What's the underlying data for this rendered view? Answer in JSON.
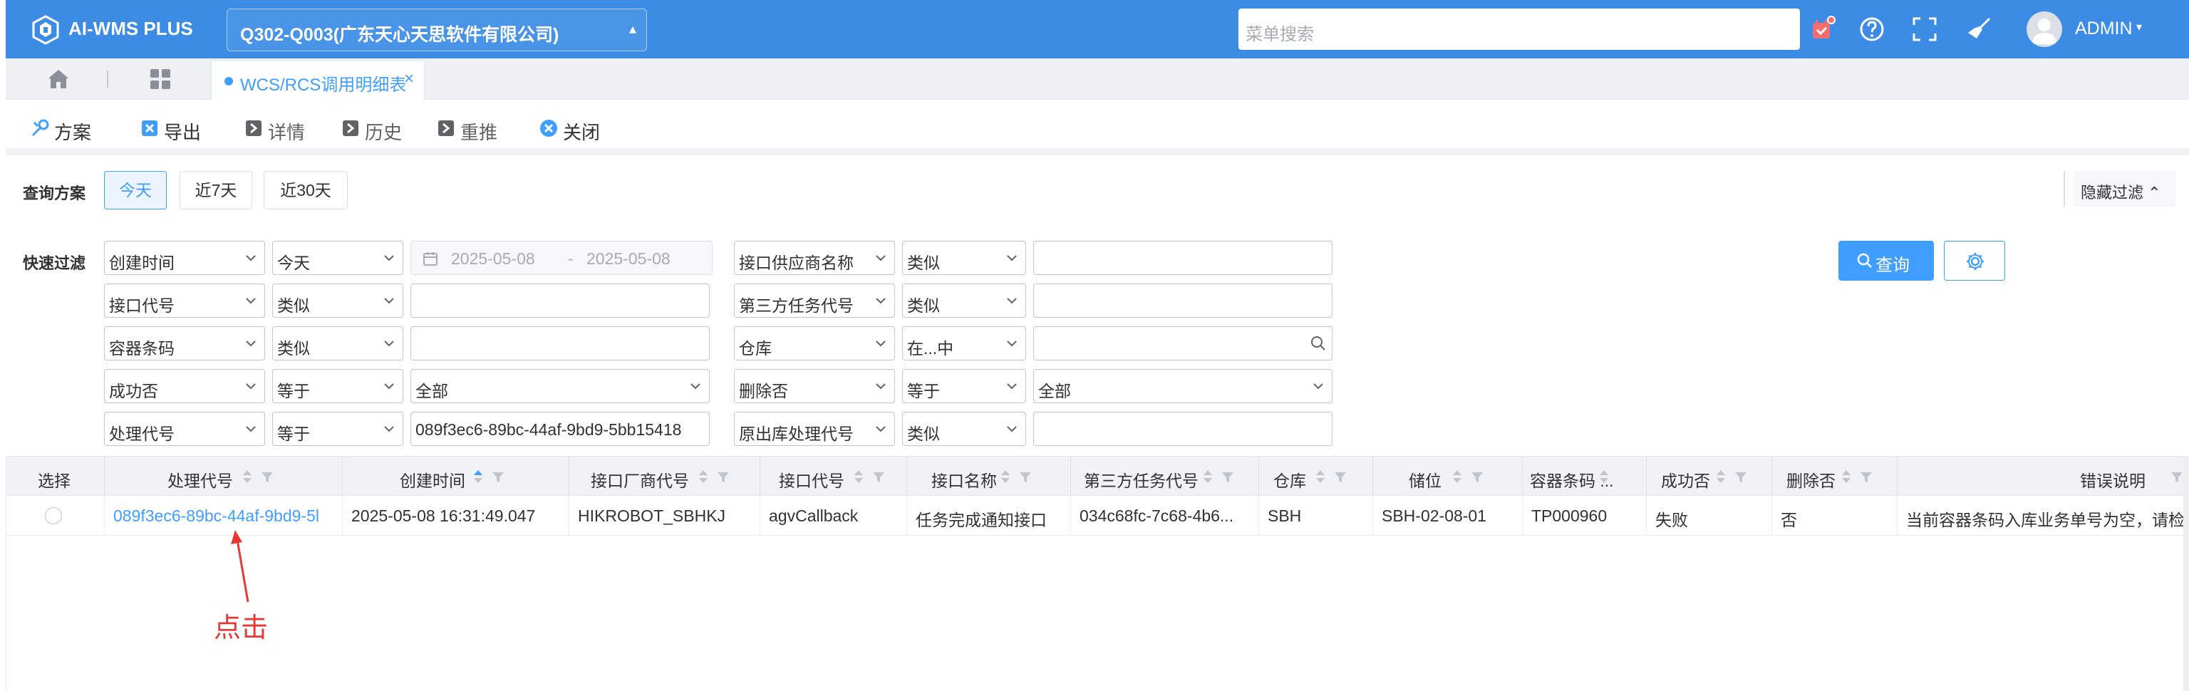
{
  "header": {
    "app_title": "AI-WMS PLUS",
    "project": "Q302-Q003(广东天心天思软件有限公司)",
    "menu_search_placeholder": "菜单搜索",
    "user": "ADMIN",
    "colors": {
      "topbar": "#3c8ce6",
      "accent": "#409eff",
      "notice_badge": "#f56c6c"
    }
  },
  "tabs": {
    "active_label": "WCS/RCS调用明细表",
    "close_glyph": "×"
  },
  "toolbar": {
    "scheme": "方案",
    "export": "导出",
    "detail": "详情",
    "history": "历史",
    "repush": "重推",
    "close": "关闭"
  },
  "query_scheme": {
    "label": "查询方案",
    "options": [
      "今天",
      "近7天",
      "近30天"
    ],
    "active": "今天",
    "hide_filter": "隐藏过滤"
  },
  "quick_filter": {
    "label": "快速过滤",
    "rows": [
      {
        "field": "创建时间",
        "op": "今天",
        "date_from": "2025-05-08",
        "date_sep": "-",
        "date_to": "2025-05-08",
        "field2": "接口供应商名称",
        "op2": "类似",
        "value2": ""
      },
      {
        "field": "接口代号",
        "op": "类似",
        "value": "",
        "field2": "第三方任务代号",
        "op2": "类似",
        "value2": ""
      },
      {
        "field": "容器条码",
        "op": "类似",
        "value": "",
        "field2": "仓库",
        "op2": "在...中",
        "value2": ""
      },
      {
        "field": "成功否",
        "op": "等于",
        "value": "全部",
        "field2": "删除否",
        "op2": "等于",
        "value2": "全部"
      },
      {
        "field": "处理代号",
        "op": "等于",
        "value": "089f3ec6-89bc-44af-9bd9-5bb15418",
        "field2": "原出库处理代号",
        "op2": "类似",
        "value2": ""
      }
    ],
    "query_button": "查询"
  },
  "table": {
    "columns": [
      "选择",
      "处理代号",
      "创建时间",
      "接口厂商代号",
      "接口代号",
      "接口名称",
      "第三方任务代号",
      "仓库",
      "储位",
      "容器条码 ...",
      "成功否",
      "删除否",
      "错误说明"
    ],
    "rows": [
      [
        "",
        "089f3ec6-89bc-44af-9bd9-5l",
        "2025-05-08 16:31:49.047",
        "HIKROBOT_SBHKJ",
        "agvCallback",
        "任务完成通知接口",
        "034c68fc-7c68-4b6...",
        "SBH",
        "SBH-02-08-01",
        "TP000960",
        "失败",
        "否",
        "当前容器条码入库业务单号为空，请检查"
      ]
    ]
  },
  "annotation": {
    "text": "点击",
    "color": "#e53935"
  }
}
